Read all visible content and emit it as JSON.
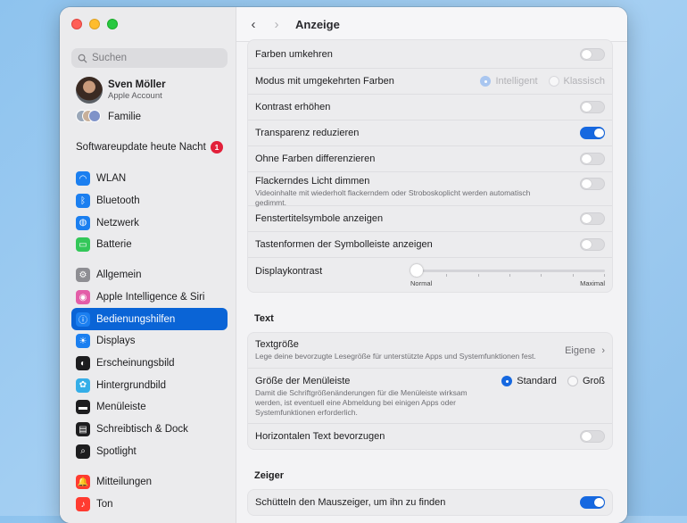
{
  "sidebar": {
    "search_placeholder": "Suchen",
    "account": {
      "name": "Sven Möller",
      "sub": "Apple Account"
    },
    "family": "Familie",
    "update": {
      "label": "Softwareupdate heute Nacht",
      "badge": "1"
    },
    "group1": [
      {
        "label": "WLAN",
        "icon": "wifi-icon",
        "color": "#1b7ff0"
      },
      {
        "label": "Bluetooth",
        "icon": "bluetooth-icon",
        "color": "#1b7ff0"
      },
      {
        "label": "Netzwerk",
        "icon": "globe-icon",
        "color": "#1b7ff0"
      },
      {
        "label": "Batterie",
        "icon": "battery-icon",
        "color": "#33c759"
      }
    ],
    "group2": [
      {
        "label": "Allgemein",
        "icon": "gear-icon",
        "color": "#8e8e93"
      },
      {
        "label": "Apple Intelligence & Siri",
        "icon": "siri-icon",
        "color": "#e35da8"
      },
      {
        "label": "Bedienungshilfen",
        "icon": "accessibility-icon",
        "color": "#1b7ff0",
        "active": true
      },
      {
        "label": "Displays",
        "icon": "sun-icon",
        "color": "#1b7ff0"
      },
      {
        "label": "Erscheinungsbild",
        "icon": "appearance-icon",
        "color": "#1d1d1f"
      },
      {
        "label": "Hintergrundbild",
        "icon": "flower-icon",
        "color": "#35aee8"
      },
      {
        "label": "Menüleiste",
        "icon": "menubar-icon",
        "color": "#1d1d1f"
      },
      {
        "label": "Schreibtisch & Dock",
        "icon": "dock-icon",
        "color": "#1d1d1f"
      },
      {
        "label": "Spotlight",
        "icon": "spotlight-icon",
        "color": "#1d1d1f"
      }
    ],
    "group3": [
      {
        "label": "Mitteilungen",
        "icon": "bell-icon",
        "color": "#ff3b30"
      },
      {
        "label": "Ton",
        "icon": "speaker-icon",
        "color": "#ff3b30"
      }
    ]
  },
  "header": {
    "title": "Anzeige"
  },
  "display": {
    "invert": "Farben umkehren",
    "invert_mode": "Modus mit umgekehrten Farben",
    "mode_smart": "Intelligent",
    "mode_classic": "Klassisch",
    "contrast": "Kontrast erhöhen",
    "transparency": "Transparenz reduzieren",
    "differentiate": "Ohne Farben differenzieren",
    "flash": "Flackerndes Licht dimmen",
    "flash_desc": "Videoinhalte mit wiederholt flackerndem oder Stroboskoplicht werden automatisch gedimmt.",
    "window_icons": "Fenstertitelsymbole anzeigen",
    "toolbar_shapes": "Tastenformen der Symbolleiste anzeigen",
    "display_contrast": "Displaykontrast",
    "slider_min": "Normal",
    "slider_max": "Maximal",
    "slider_value": 0,
    "toggles": {
      "invert": false,
      "contrast": false,
      "transparency": true,
      "differentiate": false,
      "flash": false,
      "window_icons": false,
      "toolbar_shapes": false
    }
  },
  "text_section": {
    "heading": "Text",
    "size": "Textgröße",
    "size_desc": "Lege deine bevorzugte Lesegröße für unterstützte Apps und Systemfunktionen fest.",
    "size_value": "Eigene",
    "menubar_size": "Größe der Menüleiste",
    "menubar_desc": "Damit die Schriftgrößenänderungen für die Menüleiste wirksam werden, ist eventuell eine Abmeldung bei einigen Apps oder Systemfunktionen erforderlich.",
    "menubar_standard": "Standard",
    "menubar_large": "Groß",
    "horizontal": "Horizontalen Text bevorzugen",
    "horizontal_on": false
  },
  "pointer_section": {
    "heading": "Zeiger",
    "shake": "Schütteln den Mauszeiger, um ihn zu finden",
    "shake_on": true
  }
}
